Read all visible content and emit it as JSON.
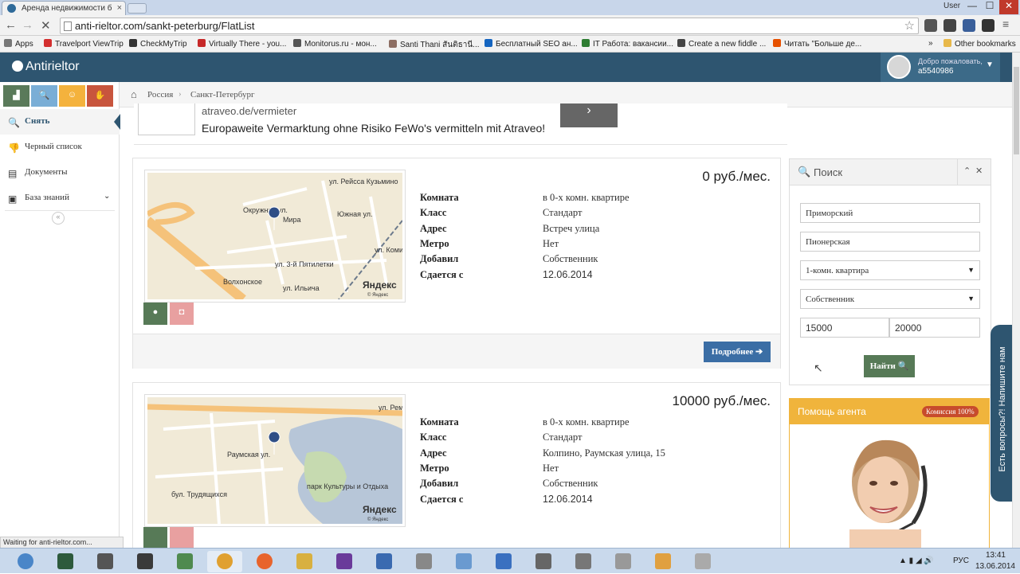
{
  "browser": {
    "tab_title": "Аренда недвижимости б",
    "url": "anti-rieltor.com/sankt-peterburg/FlatList",
    "window_controls": {
      "minimize": "—",
      "maximize": "☐",
      "close": "✕"
    },
    "user_label": "User",
    "bookmarks": [
      {
        "label": "Apps",
        "color": "#777777"
      },
      {
        "label": "Travelport ViewTrip",
        "color": "#d32f2f"
      },
      {
        "label": "CheckMyTrip",
        "color": "#333333"
      },
      {
        "label": "Virtually There - you...",
        "color": "#c62828"
      },
      {
        "label": "Monitorus.ru - мон...",
        "color": "#555555"
      },
      {
        "label": "Santi Thani สันติธานี...",
        "color": "#8d6e63"
      },
      {
        "label": "Бесплатный SEO ан...",
        "color": "#1565c0"
      },
      {
        "label": "IT Работа: вакансии...",
        "color": "#2e7d32"
      },
      {
        "label": "Create a new fiddle ...",
        "color": "#444444"
      },
      {
        "label": "Читать \"Больше де...",
        "color": "#e65100"
      }
    ],
    "bookmarks_more": "»",
    "other_bookmarks": "Other bookmarks",
    "status_text": "Waiting for anti-rieltor.com..."
  },
  "app": {
    "logo": "Antirieltor",
    "welcome": "Добро пожаловать,",
    "username": "a5540986"
  },
  "sidebar": {
    "quick_buttons": [
      {
        "name": "stats",
        "icon": "▟",
        "color": "#5a7a5a"
      },
      {
        "name": "search",
        "icon": "🔍",
        "color": "#7aaed6"
      },
      {
        "name": "users",
        "icon": "☺",
        "color": "#f4b23d"
      },
      {
        "name": "dislike",
        "icon": "✋",
        "color": "#c8553d"
      }
    ],
    "items": [
      {
        "label": "Снять",
        "icon": "🔍"
      },
      {
        "label": "Черный список",
        "icon": "👎"
      },
      {
        "label": "Документы",
        "icon": "▤"
      },
      {
        "label": "База знаний",
        "icon": "▣"
      }
    ],
    "collapse_icon": "«"
  },
  "breadcrumb": [
    "Россия",
    "Санкт-Петербург"
  ],
  "ad": {
    "url": "atraveo.de/vermieter",
    "text": "Europaweite Vermarktung ohne Risiko FeWo's vermitteln mit Atraveo!",
    "button_icon": "›"
  },
  "listings": [
    {
      "price": "0 руб./мес.",
      "props": [
        {
          "k": "Комната",
          "v": "в 0-х комн. квартире"
        },
        {
          "k": "Класс",
          "v": "Стандарт"
        },
        {
          "k": "Адрес",
          "v": "Встреч улица"
        },
        {
          "k": "Метро",
          "v": "Нет"
        },
        {
          "k": "Добавил",
          "v": "Собственник"
        },
        {
          "k": "Сдается с",
          "v": "12.06.2014"
        }
      ],
      "map_labels": [
        "Окружная ул.",
        "Мира",
        "ул. 3-й Пятилетки",
        "Волхонское",
        "ул. Ильича",
        "ул. Рейсса Кузьмино",
        "Южная ул.",
        "ул. Коми"
      ],
      "more": "Подробнее ➔"
    },
    {
      "price": "10000 руб./мес.",
      "props": [
        {
          "k": "Комната",
          "v": "в 0-х комн. квартире"
        },
        {
          "k": "Класс",
          "v": "Стандарт"
        },
        {
          "k": "Адрес",
          "v": "Колпино, Раумская улица, 15"
        },
        {
          "k": "Метро",
          "v": "Нет"
        },
        {
          "k": "Добавил",
          "v": "Собственник"
        },
        {
          "k": "Сдается с",
          "v": "12.06.2014"
        }
      ],
      "map_labels": [
        "Раумская ул.",
        "бул. Трудящихся",
        "парк Культуры и Отдыха",
        "ул. Реми"
      ]
    }
  ],
  "map_brand": "Яндекс",
  "map_copyright": "© Яндекс",
  "search": {
    "title": "Поиск",
    "district": "Приморский",
    "metro": "Пионерская",
    "rooms": "1-комн. квартира",
    "owner": "Собственник",
    "price_from": "15000",
    "price_to": "20000",
    "find_button": "Найти 🔍"
  },
  "agent": {
    "title": "Помощь агента",
    "badge": "Комиссия 100%"
  },
  "feedback": "Есть вопросы?! Напишите нам",
  "taskbar": {
    "lang": "РУС",
    "time": "13:41",
    "date": "13.06.2014"
  }
}
